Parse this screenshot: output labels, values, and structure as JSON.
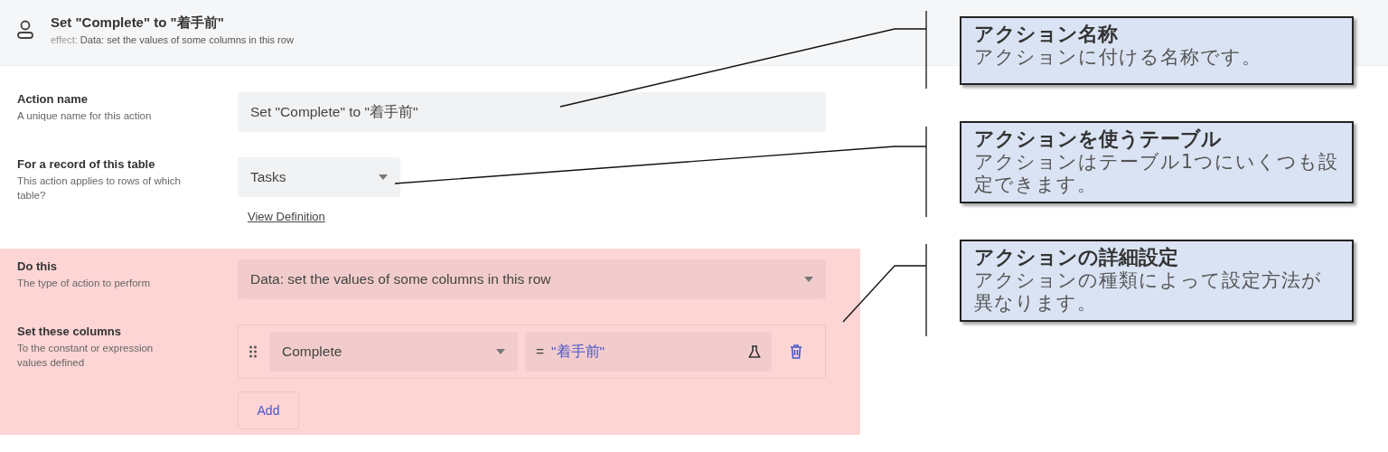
{
  "header": {
    "title": "Set \"Complete\" to \"着手前\"",
    "effect_label": "effect:",
    "effect": "Data: set the values of some columns in this row"
  },
  "sections": [
    {
      "highlighted": false,
      "fields": [
        {
          "kind": "text",
          "label": "Action name",
          "hint": "A unique name for this action",
          "value": "Set \"Complete\" to \"着手前\""
        },
        {
          "kind": "select",
          "label": "For a record of this table",
          "hint": "This action applies to rows of which table?",
          "value": "Tasks",
          "link": "View Definition"
        }
      ]
    },
    {
      "highlighted": true,
      "fields": [
        {
          "kind": "select-wide",
          "label": "Do this",
          "hint": "The type of action to perform",
          "value": "Data: set the values of some columns in this row"
        },
        {
          "kind": "columns",
          "label": "Set these columns",
          "hint": "To the constant or expression values defined",
          "rows": [
            {
              "column": "Complete",
              "operator": "=",
              "expression": "\"着手前\""
            }
          ],
          "add": "Add"
        }
      ]
    }
  ],
  "callouts": [
    {
      "title": "アクション名称",
      "body": "アクションに付ける名称です。"
    },
    {
      "title": "アクションを使うテーブル",
      "body": "アクションはテーブル1つにいくつも設定できます。"
    },
    {
      "title": "アクションの詳細設定",
      "body": "アクションの種類によって設定方法が異なります。"
    }
  ]
}
